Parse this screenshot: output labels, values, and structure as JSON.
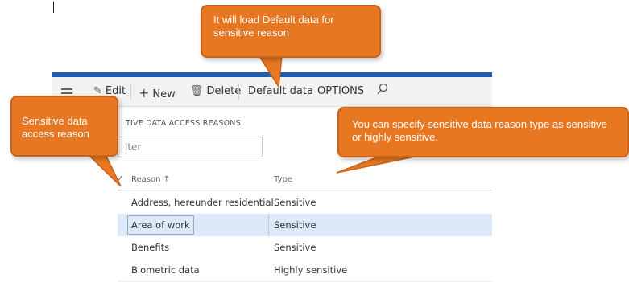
{
  "action_pane": {
    "edit": "Edit",
    "new": "New",
    "delete": "Delete",
    "default_data": "Default data",
    "options": "OPTIONS"
  },
  "page": {
    "header": "TIVE DATA ACCESS REASONS",
    "filter_placeholder": "lter"
  },
  "grid": {
    "columns": {
      "reason": "Reason ↑",
      "type": "Type"
    },
    "rows": [
      {
        "reason": "Address, hereunder residential",
        "type": "Sensitive"
      },
      {
        "reason": "Area of work",
        "type": "Sensitive"
      },
      {
        "reason": "Benefits",
        "type": "Sensitive"
      },
      {
        "reason": "Biometric data",
        "type": "Highly sensitive"
      }
    ]
  },
  "callouts": {
    "default_data": "It will load Default data for sensitive reason",
    "reason": "Sensitive data access reason",
    "type": "You can specify sensitive data reason type as sensitive or highly sensitive."
  },
  "colors": {
    "accent": "#1e5fb4",
    "callout": "#e87722",
    "selected_row": "#dbe9f8"
  },
  "icons": [
    "menu-icon",
    "edit-icon",
    "plus-icon",
    "trash-icon",
    "search-icon",
    "checkmark-icon"
  ]
}
